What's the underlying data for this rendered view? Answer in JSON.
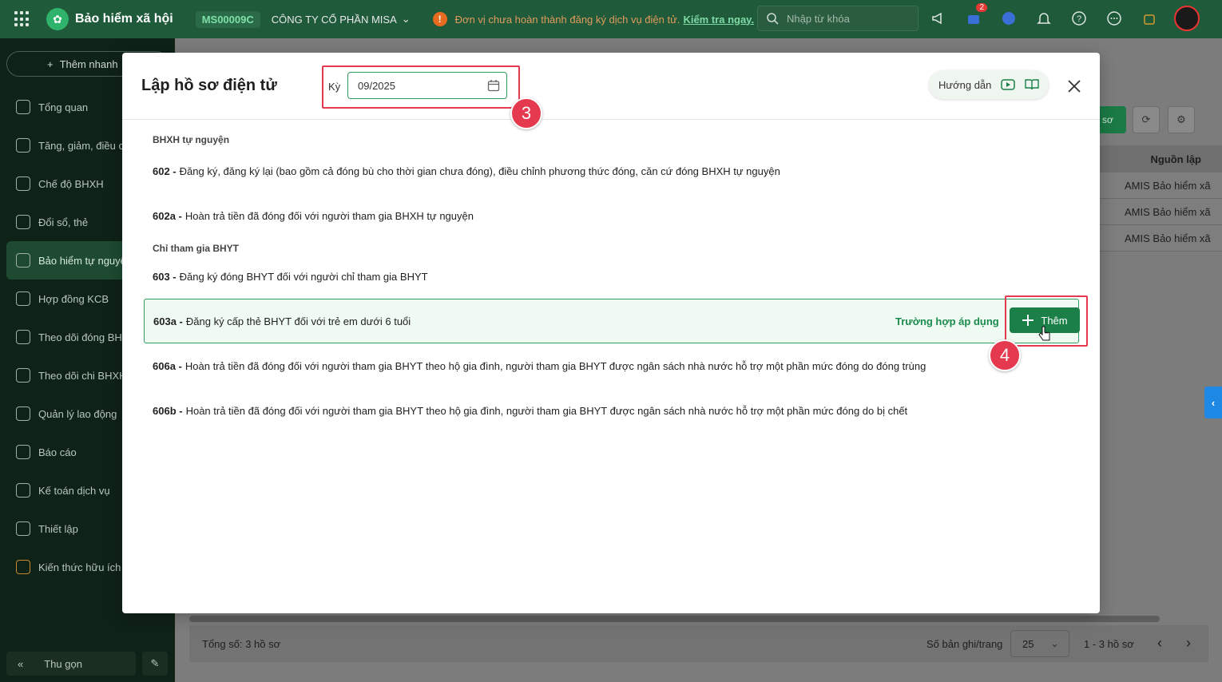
{
  "topbar": {
    "app_title": "Bảo hiểm xã hội",
    "tenant_code": "MS00009C",
    "company": "CÔNG TY CỔ PHẦN MISA",
    "warning_text": "Đơn vị chưa hoàn thành đăng ký dịch vụ điện tử.",
    "warning_link": "Kiểm tra ngay.",
    "search_placeholder": "Nhập từ khóa",
    "cart_count": "2"
  },
  "sidebar": {
    "quick_add": "Thêm nhanh",
    "items": [
      {
        "label": "Tổng quan"
      },
      {
        "label": "Tăng, giảm, điều chỉnh"
      },
      {
        "label": "Chế độ BHXH"
      },
      {
        "label": "Đổi sổ, thẻ"
      },
      {
        "label": "Bảo hiểm tự nguyện"
      },
      {
        "label": "Hợp đồng KCB"
      },
      {
        "label": "Theo dõi đóng BHXH"
      },
      {
        "label": "Theo dõi chi BHXH"
      },
      {
        "label": "Quản lý lao động"
      },
      {
        "label": "Báo cáo"
      },
      {
        "label": "Kế toán dịch vụ"
      },
      {
        "label": "Thiết lập"
      },
      {
        "label": "Kiến thức hữu ích"
      }
    ],
    "collapse_label": "Thu gọn"
  },
  "background": {
    "green_btn_label": "sơ",
    "table_header": "Nguồn lập",
    "table_rows": [
      "AMIS Bảo hiểm xã",
      "AMIS Bảo hiểm xã",
      "AMIS Bảo hiểm xã"
    ],
    "total": "Tổng số: 3 hồ sơ",
    "per_page_label": "Số bản ghi/trang",
    "page_size": "25",
    "range": "1 - 3 hồ sơ"
  },
  "modal": {
    "title": "Lập hồ sơ điện tử",
    "period_label": "Kỳ",
    "period_value": "09/2025",
    "guide_label": "Hướng dẫn",
    "step3": "3",
    "step4": "4",
    "sections": [
      {
        "title": "BHXH tự nguyện",
        "items": [
          {
            "code": "602 -",
            "text": "Đăng ký, đăng ký lại (bao gồm cả đóng bù cho thời gian chưa đóng), điều chỉnh phương thức đóng, căn cứ đóng BHXH tự nguyện"
          },
          {
            "code": "602a -",
            "text": "Hoàn trả tiền đã đóng đối với người tham gia BHXH tự nguyện"
          }
        ]
      },
      {
        "title": "Chỉ tham gia BHYT",
        "items": [
          {
            "code": "603 -",
            "text": "Đăng ký đóng BHYT đối với người chỉ tham gia BHYT"
          },
          {
            "code": "603a -",
            "text": "Đăng ký cấp thẻ BHYT đối với trẻ em dưới 6 tuổi"
          },
          {
            "code": "606a -",
            "text": "Hoàn trả tiền đã đóng đối với người tham gia BHYT theo hộ gia đình, người tham gia BHYT được ngân sách nhà nước hỗ trợ một phần mức đóng do đóng trùng"
          },
          {
            "code": "606b -",
            "text": "Hoàn trả tiền đã đóng đối với người tham gia BHYT theo hộ gia đình, người tham gia BHYT được ngân sách nhà nước hỗ trợ một phần mức đóng do bị chết"
          }
        ]
      }
    ],
    "apply_link": "Trường hợp áp dụng",
    "add_label": "Thêm"
  },
  "colors": {
    "brand_green": "#1a8048",
    "annotation_red": "#e53950"
  }
}
